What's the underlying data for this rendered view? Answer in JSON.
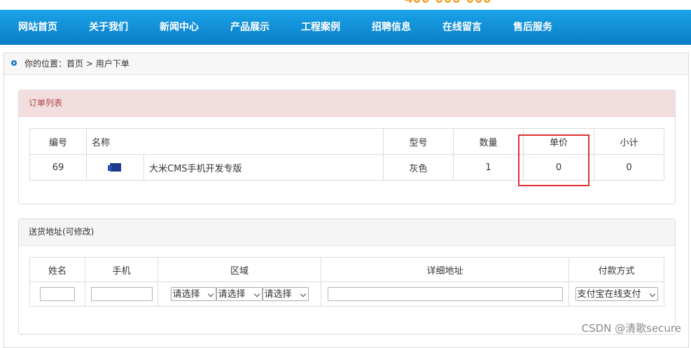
{
  "header": {
    "phone_partial": "400-000-000"
  },
  "nav": [
    "网站首页",
    "关于我们",
    "新闻中心",
    "产品展示",
    "工程案例",
    "招聘信息",
    "在线留言",
    "售后服务"
  ],
  "breadcrumb": {
    "prefix": "你的位置：",
    "home": "首页",
    "separator": " > ",
    "current": "用户下单"
  },
  "order_panel": {
    "title": "订单列表",
    "columns": [
      "编号",
      "名称",
      "型号",
      "数量",
      "单价",
      "小计"
    ],
    "rows": [
      {
        "id": "69",
        "name": "大米CMS手机开发专版",
        "model": "灰色",
        "qty": "1",
        "price": "0",
        "subtotal": "0"
      }
    ]
  },
  "ship_panel": {
    "title": "送货地址(可修改)",
    "columns": [
      "姓名",
      "手机",
      "区域",
      "详细地址",
      "付款方式"
    ],
    "region_selects": [
      "请选择",
      "请选择",
      "请选择"
    ],
    "payment_selected": "支付宝在线支付"
  },
  "watermark": "CSDN @清歌secure"
}
